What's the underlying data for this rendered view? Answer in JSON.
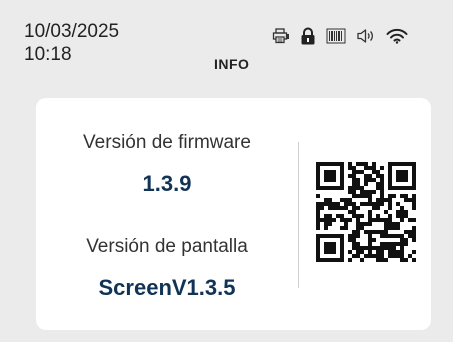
{
  "header": {
    "date": "10/03/2025",
    "time": "10:18",
    "title": "INFO",
    "status_icons": [
      "printer-icon",
      "lock-icon",
      "barcode-icon",
      "speaker-icon",
      "wifi-icon"
    ]
  },
  "info": {
    "firmware_label": "Versión de firmware",
    "firmware_value": "1.3.9",
    "screen_label": "Versión de pantalla",
    "screen_value": "ScreenV1.3.5",
    "qr_icon": "qr-code"
  },
  "colors": {
    "background": "#ebebeb",
    "card": "#ffffff",
    "value_text": "#113355"
  }
}
